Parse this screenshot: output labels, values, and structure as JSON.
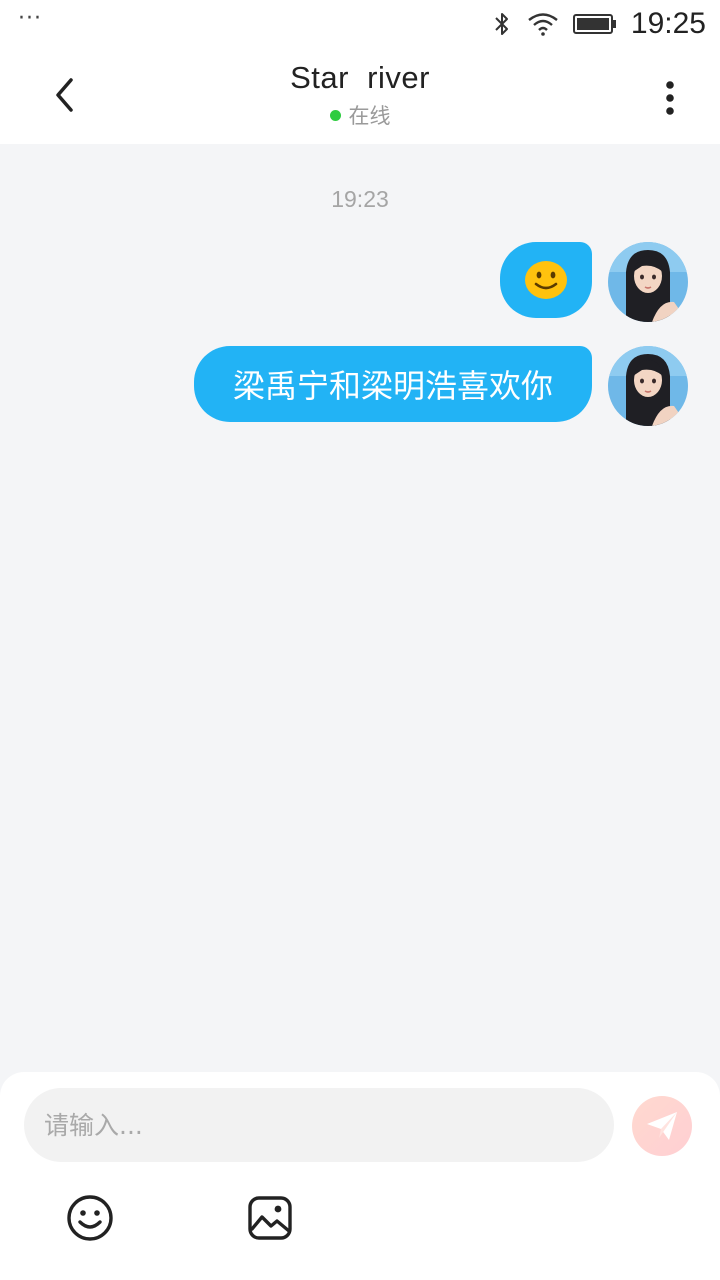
{
  "status_bar": {
    "dots": "···",
    "time": "19:25",
    "icons": [
      "bluetooth-icon",
      "wifi-icon",
      "battery-icon"
    ]
  },
  "header": {
    "title": "Star  river",
    "presence": "在线",
    "presence_color": "#2ecc40",
    "icons": [
      "back-arrow-icon",
      "more-vertical-icon"
    ]
  },
  "chat": {
    "timestamp": "19:23",
    "messages": [
      {
        "type": "emoji",
        "content": "🙂"
      },
      {
        "type": "text",
        "content": "梁禹宁和梁明浩喜欢你"
      }
    ],
    "bubble_color": "#22b3f5"
  },
  "composer": {
    "placeholder": "请输入...",
    "value": "",
    "icons": [
      "send-icon",
      "emoji-icon",
      "image-icon"
    ]
  }
}
